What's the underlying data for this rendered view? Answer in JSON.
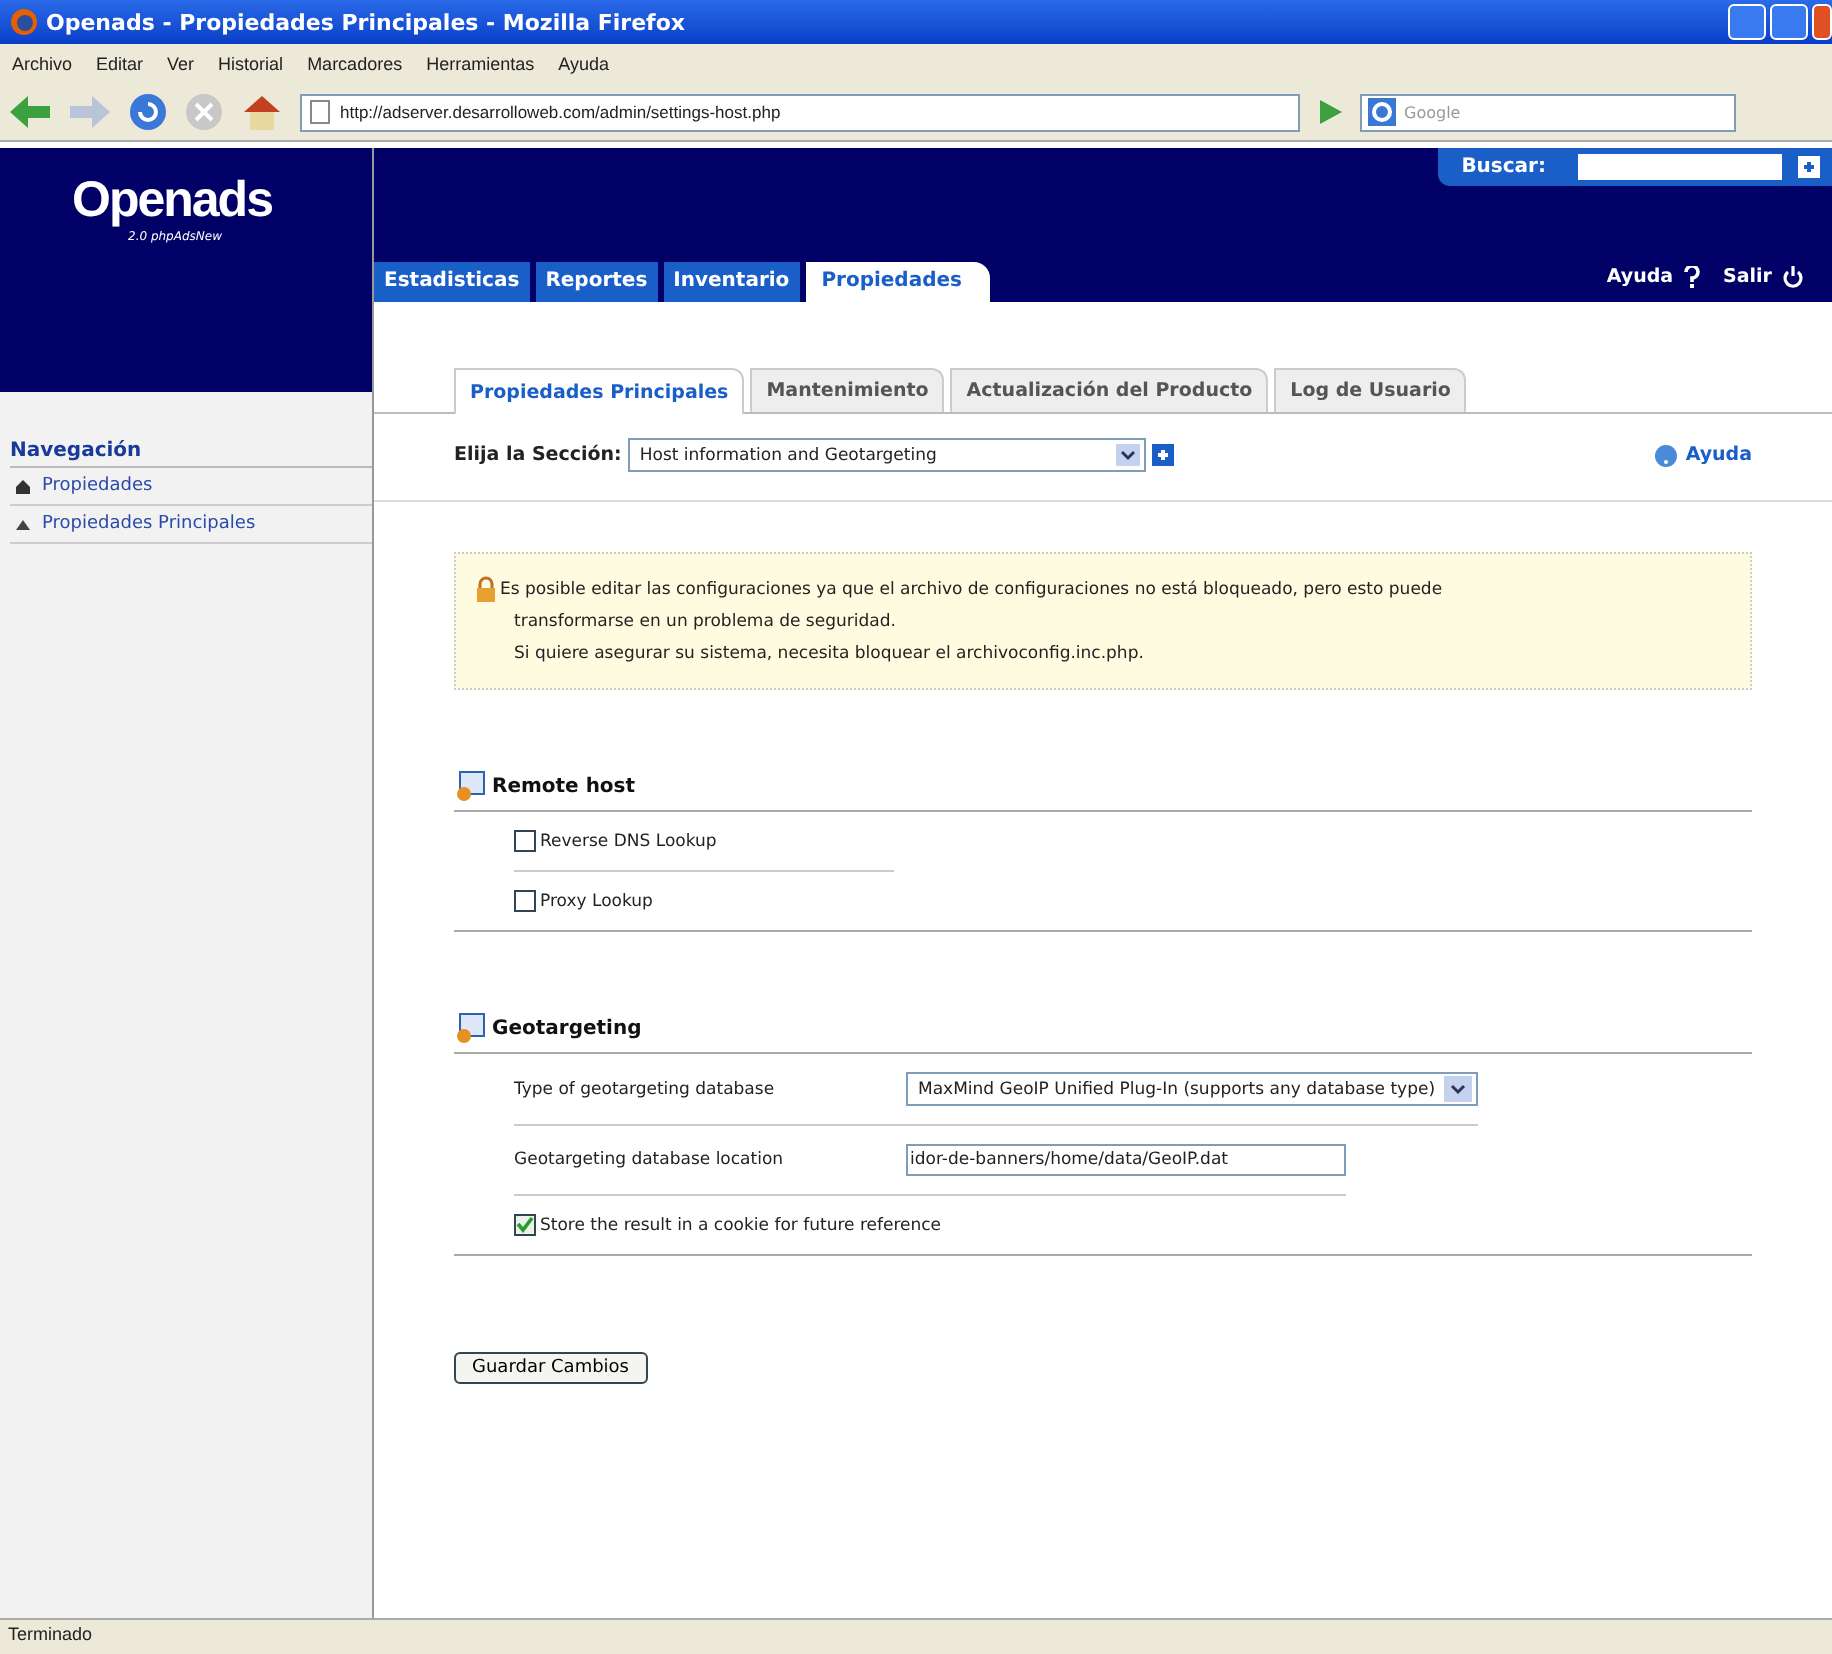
{
  "window": {
    "title": "Openads - Propiedades Principales - Mozilla Firefox"
  },
  "menu": [
    "Archivo",
    "Editar",
    "Ver",
    "Historial",
    "Marcadores",
    "Herramientas",
    "Ayuda"
  ],
  "toolbar": {
    "url": "http://adserver.desarrolloweb.com/admin/settings-host.php",
    "search_placeholder": "Google"
  },
  "header": {
    "logo": "Openads",
    "logo_subtitle": "2.0 phpAdsNew",
    "search_label": "Buscar:",
    "main_tabs": [
      {
        "label": "Estadisticas",
        "selected": false
      },
      {
        "label": "Reportes",
        "selected": false
      },
      {
        "label": "Inventario",
        "selected": false
      },
      {
        "label": "Propiedades",
        "selected": true
      }
    ],
    "links": [
      {
        "label": "Ayuda",
        "kind": "help"
      },
      {
        "label": "Salir",
        "kind": "logout"
      }
    ]
  },
  "sidebar": {
    "heading": "Navegación",
    "items": [
      {
        "label": "Propiedades",
        "kind": "section"
      },
      {
        "label": "Propiedades Principales",
        "kind": "page"
      }
    ]
  },
  "sub_tabs": [
    {
      "label": "Propiedades Principales",
      "selected": true
    },
    {
      "label": "Mantenimiento",
      "selected": false
    },
    {
      "label": "Actualización del Producto",
      "selected": false
    },
    {
      "label": "Log de Usuario",
      "selected": false
    }
  ],
  "section_chooser": {
    "label": "Elija la Sección:",
    "value": "Host information and Geotargeting",
    "help": "Ayuda"
  },
  "notice": {
    "lines": [
      "Es posible editar las configuraciones ya que el archivo de configuraciones no está bloqueado, pero esto puede",
      "transformarse en un problema de seguridad.",
      "Si quiere asegurar su sistema, necesita bloquear el archivoconfig.inc.php."
    ]
  },
  "groups": [
    {
      "title": "Remote host",
      "fields": [
        {
          "kind": "checkbox",
          "label": "Reverse DNS Lookup",
          "checked": false
        },
        {
          "kind": "checkbox",
          "label": "Proxy Lookup",
          "checked": false
        }
      ]
    },
    {
      "title": "Geotargeting",
      "fields": [
        {
          "kind": "select",
          "label": "Type of geotargeting database",
          "value": "MaxMind GeoIP Unified Plug-In (supports any database type)"
        },
        {
          "kind": "text",
          "label": "Geotargeting database location",
          "value": "idor-de-banners/home/data/GeoIP.dat"
        },
        {
          "kind": "checkbox",
          "label": "Store the result in a cookie for future reference",
          "checked": true
        }
      ]
    }
  ],
  "save_button": "Guardar Cambios",
  "status_bar": "Terminado"
}
